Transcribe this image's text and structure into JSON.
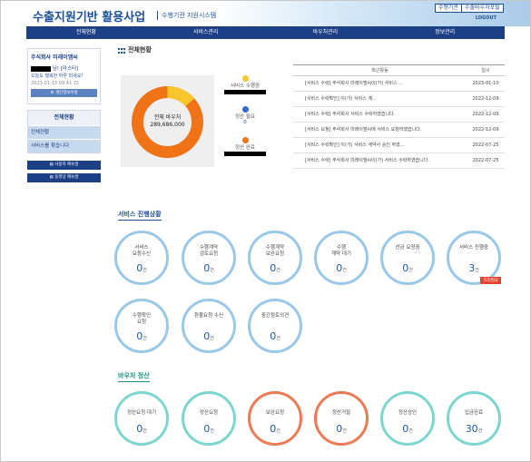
{
  "header": {
    "title": "수출지원기반 활용사업",
    "subtitle": "수행기관 지원시스템",
    "btn_agency": "수행기관",
    "btn_portal": "수출바우처포털",
    "logout": "LOGOUT"
  },
  "nav": [
    "전체현황",
    "서비스관리",
    "바우처관리",
    "정보관리"
  ],
  "user": {
    "company": "주식회사 미래이엠씨",
    "name_suffix": "님! [마스터]",
    "greeting": "오늘도 행복한 하루 되세요!",
    "login_time": "2023-01-13 09:41:15",
    "edit_button": "개인정보수정"
  },
  "side_menu": {
    "title": "전체현황",
    "items": [
      "전체현황",
      "서비스를 찾습니다"
    ]
  },
  "manuals": [
    "사용자 매뉴얼",
    "동영상 매뉴얼"
  ],
  "page_title": "전체현황",
  "donut": {
    "label": "전체 바우처",
    "total": "289,686,000",
    "legend": [
      {
        "label": "서비스 수행중",
        "value": "",
        "color": "#f7c52c"
      },
      {
        "label": "정산 필요",
        "value": "0",
        "color": "#2f6bd1"
      },
      {
        "label": "정산 완료",
        "value": "",
        "color": "#f07318"
      }
    ]
  },
  "activity": {
    "col_activity": "최근활동",
    "col_date": "일시",
    "rows": [
      {
        "text": "[서비스 수락] 주식회사 미래이엠씨이(가)                서비스 ...",
        "date": "2023-01-10"
      },
      {
        "text": "[서비스 수락확인]                  이(가) 서비스 계...",
        "date": "2022-12-09"
      },
      {
        "text": "[서비스 수락] 주식회사                서비스 수락하였습니다.",
        "date": "2022-12-09"
      },
      {
        "text": "[서비스 요청] 주식회사 미래이엠씨에 서비스 요청하였습니다.",
        "date": "2022-12-09"
      },
      {
        "text": "[서비스 수락확인]              이(가) 서비스 계약서 승인 하였...",
        "date": "2022-07-25"
      },
      {
        "text": "[서비스 수락] 주식회사 미래이엠씨이(가) 서비스 수락하였습니다.",
        "date": "2022-07-25"
      }
    ]
  },
  "service_section": {
    "title": "서비스 진행상황",
    "items": [
      {
        "name": "서비스\n요청수신",
        "count": "0",
        "unit": "건"
      },
      {
        "name": "수행계약\n검토요청",
        "count": "0",
        "unit": "건"
      },
      {
        "name": "수행계약\n보완요청",
        "count": "0",
        "unit": "건"
      },
      {
        "name": "수행\n계약 대기",
        "count": "0",
        "unit": "건"
      },
      {
        "name": "선금 요청중",
        "count": "0",
        "unit": "건"
      },
      {
        "name": "서비스 진행중",
        "count": "3",
        "unit": "건",
        "badge": "처리필요"
      },
      {
        "name": "수행확인\n요청",
        "count": "0",
        "unit": "건"
      },
      {
        "name": "환불요청 수신",
        "count": "0",
        "unit": "건"
      },
      {
        "name": "중간점토의견",
        "count": "0",
        "unit": "건"
      }
    ]
  },
  "voucher_section": {
    "title": "바우처 정산",
    "items": [
      {
        "name": "정산요청 대기",
        "count": "0",
        "unit": "건",
        "style": "teal"
      },
      {
        "name": "정산요청",
        "count": "0",
        "unit": "건",
        "style": "teal"
      },
      {
        "name": "보완요청",
        "count": "0",
        "unit": "건",
        "style": "orange"
      },
      {
        "name": "정산거절",
        "count": "0",
        "unit": "건",
        "style": "orange"
      },
      {
        "name": "정산승인",
        "count": "0",
        "unit": "건",
        "style": "teal"
      },
      {
        "name": "입금완료",
        "count": "30",
        "unit": "건",
        "style": "teal"
      }
    ]
  }
}
